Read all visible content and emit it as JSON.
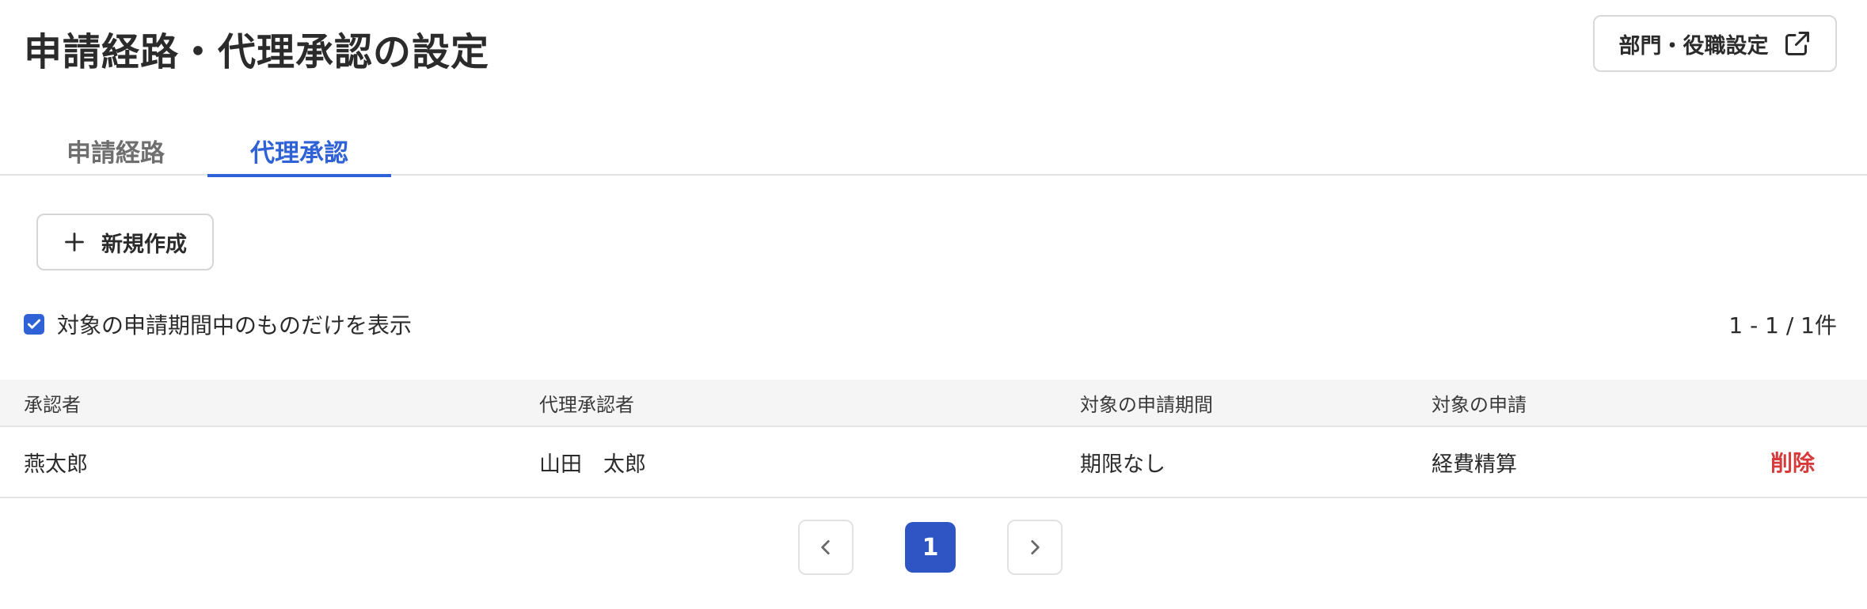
{
  "header": {
    "title": "申請経路・代理承認の設定",
    "settings_button_label": "部門・役職設定",
    "settings_button_icon": "external-link-icon"
  },
  "tabs": [
    {
      "label": "申請経路",
      "active": false
    },
    {
      "label": "代理承認",
      "active": true
    }
  ],
  "toolbar": {
    "new_button_label": "新規作成",
    "new_button_icon": "plus-icon"
  },
  "filter": {
    "checkbox_label": "対象の申請期間中のものだけを表示",
    "checked": true
  },
  "count_label": "1 - 1 / 1件",
  "table": {
    "headers": [
      "承認者",
      "代理承認者",
      "対象の申請期間",
      "対象の申請"
    ],
    "rows": [
      {
        "approver": "燕太郎",
        "proxy_approver": "山田　太郎",
        "period": "期限なし",
        "target": "経費精算",
        "action_label": "削除"
      }
    ]
  },
  "pagination": {
    "current_page": "1",
    "prev_icon": "chevron-left-icon",
    "next_icon": "chevron-right-icon"
  },
  "colors": {
    "accent": "#2f62d6",
    "page_active": "#2f55c4",
    "danger": "#d63a3a",
    "header_bg": "#f6f5f5"
  }
}
